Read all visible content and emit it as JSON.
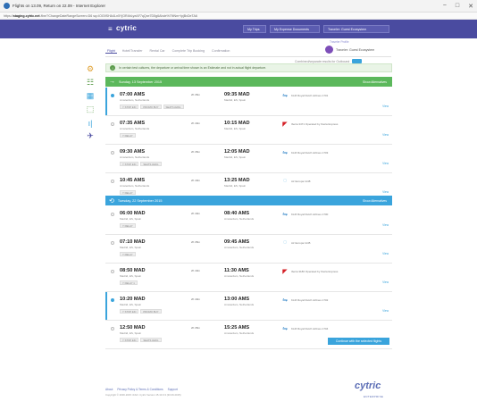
{
  "window": {
    "title": "Flights on 13.09, Return on 22.09 - Internet Explorer",
    "controls": [
      "−",
      "□",
      "✕"
    ]
  },
  "address": {
    "scheme": "https://",
    "host": "staging.cytric.net",
    "path": "/ibe/?ChangeDateRangeScreen=D6 sq=IOG9SHA4Ln5YjOR4bLyeAF7qQxe7D5g6Ahde%79iNm+lpjBxDeTA6"
  },
  "nav": {
    "menu_icon": "≡",
    "logo": "cytric",
    "buttons": [
      "My Trips",
      "My Expense Documents",
      "Traveler: Guest Ecosystem"
    ]
  },
  "profile": {
    "tag": "Traveler Profile",
    "name": "Traveler: Guest Ecosystem"
  },
  "steps": [
    "Flight",
    "Hotel/Transfer",
    "Rental Car",
    "Complete Trip Booking",
    "Confirmation"
  ],
  "active_step": 0,
  "toggle": {
    "label": "Combined/separate results for Outbound"
  },
  "info": "In certain test cultures, the departure or arrival time shown is an Estimate and not in actual flight departure.",
  "sidebar_icons": [
    "sorting-icon",
    "filter-icon",
    "airline-icon",
    "price-icon",
    "stops-icon",
    "plane-icon"
  ],
  "sections": [
    {
      "icon": "→",
      "title": "Sunday, 13 September 2015",
      "select_all": "Show Alternatives",
      "color": "#5cb85c",
      "flights": [
        {
          "dep": "07:00 AMS",
          "depsub": "Amsterdam, Netherlands",
          "dur": "2h 35m",
          "arr": "09:35 MAD",
          "arrsub": "Madrid, ES, Spain",
          "airline": "KLM Royal Dutch Airlines 1701",
          "airline_icon": "air-logo-icon",
          "tags": [
            "Y STOP EKI",
            "PROMO BUY",
            "SEATS AVAIL"
          ],
          "view": "View",
          "selected": true
        },
        {
          "dep": "07:35 AMS",
          "depsub": "Amsterdam, Netherlands",
          "dur": "2h 40m",
          "arr": "10:15 MAD",
          "arrsub": "Madrid, ES, Spain",
          "airline": "Iberia 3471 Operated by Iberia Express",
          "airline_icon": "iberia-icon",
          "tags": [
            "Y DELAY"
          ],
          "view": "View",
          "selected": false
        },
        {
          "dep": "09:30 AMS",
          "depsub": "Amsterdam, Netherlands",
          "dur": "2h 35m",
          "arr": "12:05 MAD",
          "arrsub": "Madrid, ES, Spain",
          "airline": "KLM Royal Dutch Airlines 1703",
          "airline_icon": "air-logo-icon",
          "tags": [
            "Y STOP EKI",
            "SEATS AVAIL"
          ],
          "view": "View",
          "selected": false
        },
        {
          "dep": "10:45 AMS",
          "depsub": "Amsterdam, Netherlands",
          "dur": "2h 40m",
          "arr": "13:25 MAD",
          "arrsub": "Madrid, ES, Spain",
          "airline": "Air Europa 1148",
          "airline_icon": "aireuropa-icon",
          "tags": [
            "Y DELAY"
          ],
          "view": "View",
          "selected": false
        }
      ]
    },
    {
      "icon": "⟲",
      "title": "Tuesday, 22 September 2015",
      "select_all": "Show Alternatives",
      "color": "#3aa4dc",
      "flights": [
        {
          "dep": "06:00 MAD",
          "depsub": "Madrid, ES, Spain",
          "dur": "2h 40m",
          "arr": "08:40 AMS",
          "arrsub": "Amsterdam, Netherlands",
          "airline": "KLM Royal Dutch Airlines 1700",
          "airline_icon": "air-logo-icon",
          "tags": [
            "Y DELAY"
          ],
          "view": "View",
          "selected": false
        },
        {
          "dep": "07:10 MAD",
          "depsub": "Madrid, ES, Spain",
          "dur": "2h 35m",
          "arr": "09:45 AMS",
          "arrsub": "Amsterdam, Netherlands",
          "airline": "Air Europa 1145",
          "airline_icon": "aireuropa-icon",
          "tags": [
            "Y DELAY"
          ],
          "view": "View",
          "selected": false
        },
        {
          "dep": "08:50 MAD",
          "depsub": "Madrid, ES, Spain",
          "dur": "2h 40m",
          "arr": "11:30 AMS",
          "arrsub": "Amsterdam, Netherlands",
          "airline": "Iberia 3180 Operated by Iberia Express",
          "airline_icon": "iberia-icon",
          "tags": [
            "Y DELAY 1"
          ],
          "view": "View",
          "selected": false
        },
        {
          "dep": "10:20 MAD",
          "depsub": "Madrid, ES, Spain",
          "dur": "2h 40m",
          "arr": "13:00 AMS",
          "arrsub": "Amsterdam, Netherlands",
          "airline": "KLM Royal Dutch Airlines 1702",
          "airline_icon": "air-logo-icon",
          "tags": [
            "Y STOP EKI",
            "PROMO BUY"
          ],
          "view": "View",
          "selected": true
        },
        {
          "dep": "12:50 MAD",
          "depsub": "Madrid, ES, Spain",
          "dur": "2h 35m",
          "arr": "15:25 AMS",
          "arrsub": "Amsterdam, Netherlands",
          "airline": "KLM Royal Dutch Airlines 1704",
          "airline_icon": "air-logo-icon",
          "tags": [
            "Y STOP EKI",
            "SEATS AVAIL"
          ],
          "view": "View",
          "selected": false
        }
      ]
    }
  ],
  "continue_button": "Continue with the selected flights",
  "footer": {
    "links": [
      "About",
      "Privacy Policy & Terms & Conditions",
      "Support"
    ],
    "copy": "Copyright © 2000-2015 i:FAO. Cytric Version 15.10.0.3 (30.09.2015)",
    "logo": "cytric",
    "sub": "ENTERPRISE"
  },
  "colors": {
    "nav": "#4a4ba0",
    "accent": "#3aa4dc",
    "outbound": "#5cb85c",
    "return": "#3aa4dc"
  }
}
